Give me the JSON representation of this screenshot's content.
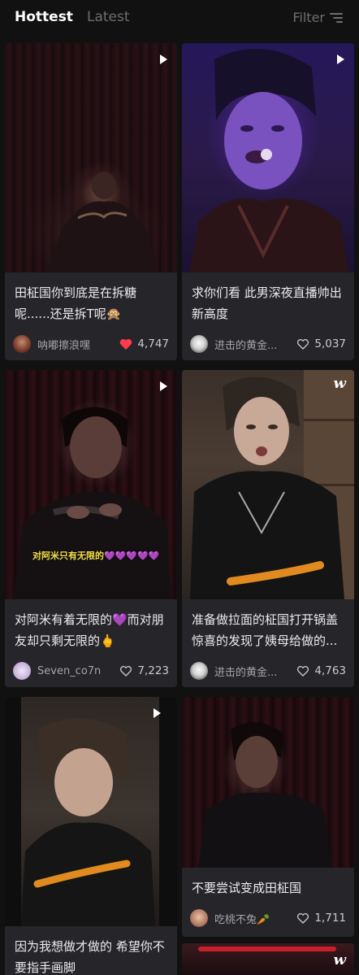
{
  "tabs": {
    "hottest": "Hottest",
    "latest": "Latest"
  },
  "filter": {
    "label": "Filter",
    "icon": "filter-lines-icon"
  },
  "posts": [
    {
      "caption": "田柾国你到底是在拆糖呢......还是拆T呢🙊",
      "author": "呐嘟擦浪嘿",
      "likes": "4,747",
      "liked": true,
      "media": "video"
    },
    {
      "caption": "求你们看 此男深夜直播帅出新高度",
      "author": "进击的黄金...",
      "likes": "5,037",
      "liked": false,
      "media": "video"
    },
    {
      "caption": "对阿米有着无限的💜而对朋友却只剩无限的🖕",
      "author": "Seven_co7n",
      "likes": "7,223",
      "liked": false,
      "media": "video",
      "overlay_text": "对阿米只有无限的💜💜💜💜💜"
    },
    {
      "caption": "准备做拉面的柾国打开锅盖惊喜的发现了姨母给做的...",
      "author": "进击的黄金...",
      "likes": "4,763",
      "liked": false,
      "media": "image"
    },
    {
      "caption": "因为我想做才做的 希望你不要指手画脚",
      "author": "",
      "likes": "",
      "liked": false,
      "media": "video"
    },
    {
      "caption": "不要尝试变成田柾国",
      "author": "吃桃不兔🥕",
      "likes": "1,711",
      "liked": false,
      "media": "image"
    }
  ],
  "colors": {
    "background": "#111112",
    "card": "#26262a",
    "liked_heart": "#ff3b4e",
    "inactive": "#6d6e73"
  }
}
